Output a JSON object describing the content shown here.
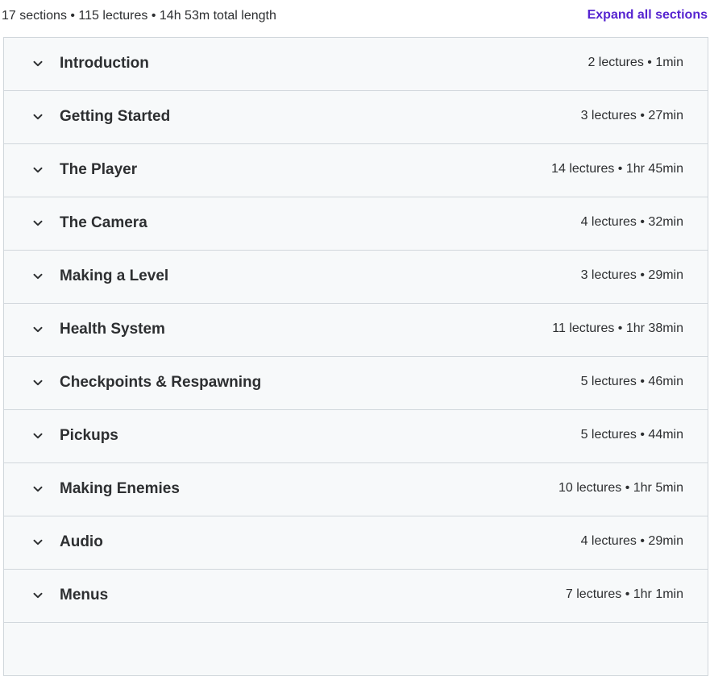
{
  "header": {
    "summary": "17 sections • 115 lectures • 14h 53m total length",
    "expand_all_label": "Expand all sections"
  },
  "colors": {
    "accent": "#5624d0",
    "row_background": "#f7f9fa",
    "border": "#d1d7dc",
    "text": "#2d2f31"
  },
  "sections": [
    {
      "title": "Introduction",
      "meta": "2 lectures • 1min",
      "icon": "chevron-down-icon"
    },
    {
      "title": "Getting Started",
      "meta": "3 lectures • 27min",
      "icon": "chevron-down-icon"
    },
    {
      "title": "The Player",
      "meta": "14 lectures • 1hr 45min",
      "icon": "chevron-down-icon"
    },
    {
      "title": "The Camera",
      "meta": "4 lectures • 32min",
      "icon": "chevron-down-icon"
    },
    {
      "title": "Making a Level",
      "meta": "3 lectures • 29min",
      "icon": "chevron-down-icon"
    },
    {
      "title": "Health System",
      "meta": "11 lectures • 1hr 38min",
      "icon": "chevron-down-icon"
    },
    {
      "title": "Checkpoints & Respawning",
      "meta": "5 lectures • 46min",
      "icon": "chevron-down-icon"
    },
    {
      "title": "Pickups",
      "meta": "5 lectures • 44min",
      "icon": "chevron-down-icon"
    },
    {
      "title": "Making Enemies",
      "meta": "10 lectures • 1hr 5min",
      "icon": "chevron-down-icon"
    },
    {
      "title": "Audio",
      "meta": "4 lectures • 29min",
      "icon": "chevron-down-icon"
    },
    {
      "title": "Menus",
      "meta": "7 lectures • 1hr 1min",
      "icon": "chevron-down-icon"
    }
  ]
}
